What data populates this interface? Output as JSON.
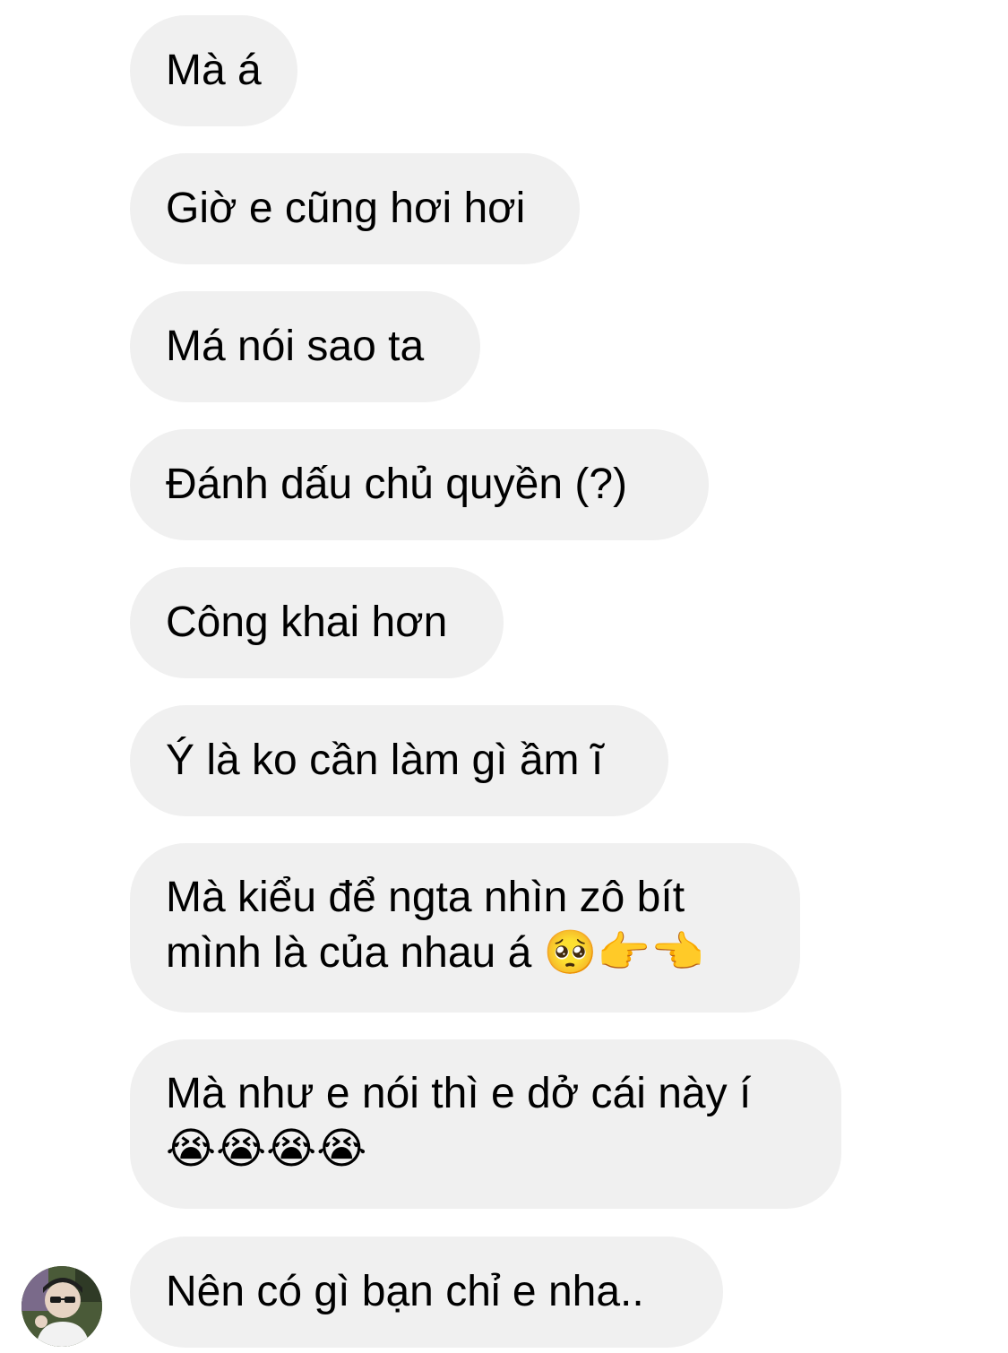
{
  "messages": [
    {
      "text": "Mà á"
    },
    {
      "text": "Giờ e cũng hơi hơi"
    },
    {
      "text": "Má nói sao ta"
    },
    {
      "text": "Đánh dấu chủ quyền (?)"
    },
    {
      "text": "Công khai hơn"
    },
    {
      "text": "Ý là ko cần làm gì ầm ĩ"
    },
    {
      "lines": [
        "Mà kiểu để ngta nhìn zô bít",
        "mình là của nhau á 🥺👉👈"
      ]
    },
    {
      "lines": [
        "Mà như e nói thì e dở cái này í",
        "😭😭😭😭"
      ]
    },
    {
      "text": "Nên có gì bạn chỉ e nha.."
    }
  ],
  "colors": {
    "bubble_bg": "#f0f0f0",
    "text": "#000000",
    "background": "#ffffff"
  },
  "avatar": {
    "icon": "profile-photo-avatar"
  }
}
